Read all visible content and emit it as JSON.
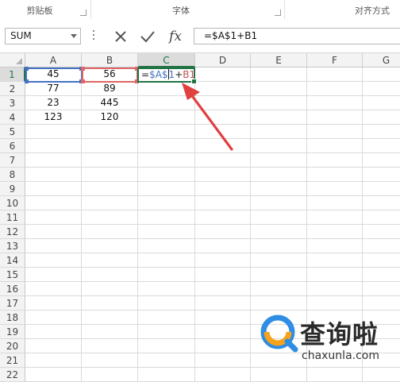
{
  "ribbon": {
    "groups": [
      {
        "label": "剪贴板"
      },
      {
        "label": "字体"
      },
      {
        "label": "对齐方式"
      }
    ]
  },
  "formula_bar": {
    "name_box": "SUM",
    "formula": "=$A$1+B1",
    "icons": [
      "cancel-icon",
      "enter-icon",
      "fx-icon"
    ],
    "fx_label": "fx"
  },
  "columns": [
    "A",
    "B",
    "C",
    "D",
    "E",
    "F",
    "G"
  ],
  "rows": [
    "1",
    "2",
    "3",
    "4",
    "5",
    "6",
    "7",
    "8",
    "9",
    "10",
    "11",
    "12",
    "13",
    "14",
    "15",
    "16",
    "17",
    "18",
    "19",
    "20",
    "21",
    "22"
  ],
  "cells": {
    "A1": "45",
    "B1": "56",
    "A2": "77",
    "B2": "89",
    "A3": "23",
    "B3": "445",
    "A4": "123",
    "B4": "120"
  },
  "editing": {
    "cell": "C1",
    "parts": {
      "eq": "=",
      "ref_a": "$A$",
      "ref_a2": "1",
      "plus": "+",
      "ref_b": "B1"
    }
  },
  "colors": {
    "accent": "#217346",
    "ref_a": "#4472c4",
    "ref_b": "#e06666",
    "arrow": "#e04040"
  },
  "watermark": {
    "title": "查询啦",
    "domain": "chaxunla.com"
  }
}
